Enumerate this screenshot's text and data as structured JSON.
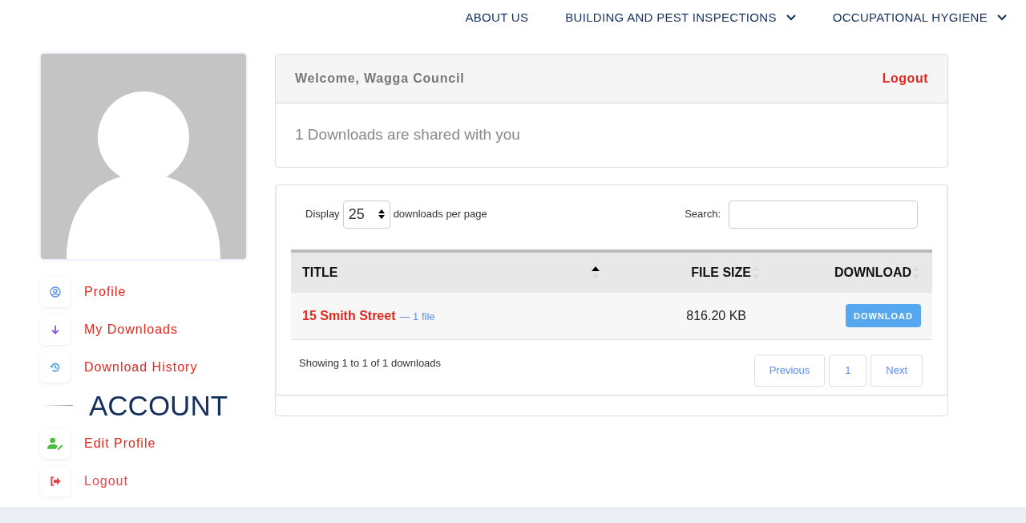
{
  "nav": [
    {
      "label": "ABOUT US",
      "dropdown": false
    },
    {
      "label": "BUILDING AND PEST INSPECTIONS",
      "dropdown": true
    },
    {
      "label": "OCCUPATIONAL HYGIENE",
      "dropdown": true
    }
  ],
  "sidebar": {
    "menu": [
      {
        "label": "Profile",
        "kind": "profile"
      },
      {
        "label": "My Downloads",
        "kind": "downloads"
      },
      {
        "label": "Download History",
        "kind": "history"
      }
    ],
    "heading": "ACCOUNT",
    "account": [
      {
        "label": "Edit Profile",
        "kind": "edit"
      },
      {
        "label": "Logout",
        "kind": "logout"
      }
    ]
  },
  "welcome": {
    "greeting": "Welcome, Wagga Council",
    "logout": "Logout",
    "message": "1 Downloads are shared with you"
  },
  "table": {
    "display_label": "Display",
    "per_page": "25",
    "per_page_suffix": "downloads per page",
    "search_label": "Search:",
    "columns": [
      {
        "label": "TITLE",
        "sorted": true
      },
      {
        "label": "FILE SIZE",
        "sorted": false
      },
      {
        "label": "DOWNLOAD",
        "sorted": false
      }
    ],
    "rows": [
      {
        "title": "15 Smith Street",
        "files": "— 1 file",
        "size": "816.20 KB",
        "button": "DOWNLOAD"
      }
    ],
    "info": "Showing 1 to 1 of 1 downloads",
    "pagination": [
      {
        "label": "Previous",
        "selected": false
      },
      {
        "label": "1",
        "selected": false
      },
      {
        "label": "Next",
        "selected": false
      }
    ]
  }
}
